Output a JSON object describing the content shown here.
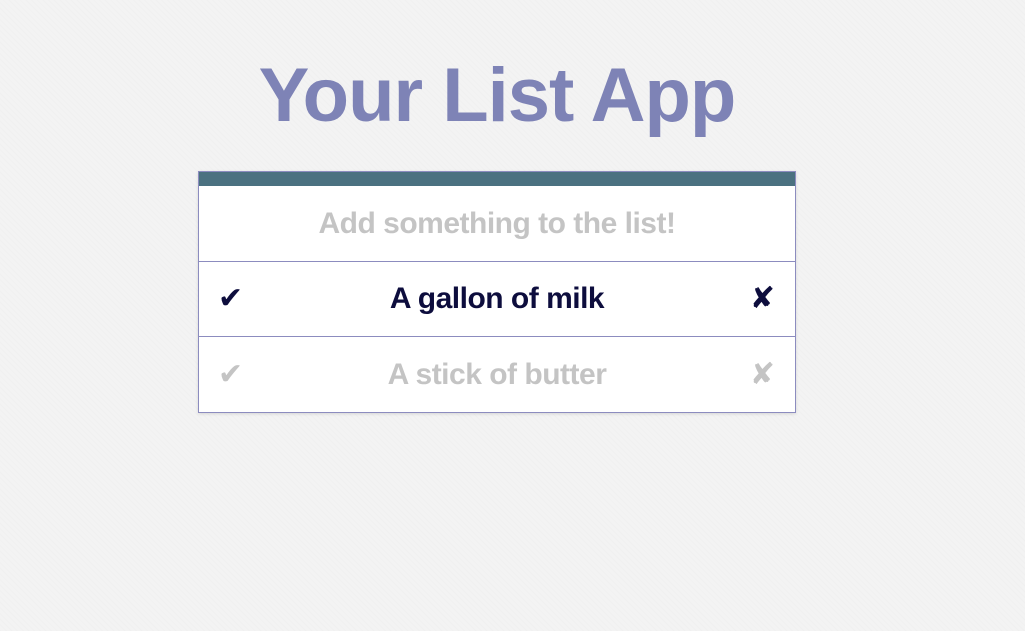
{
  "app": {
    "title": "Your List App"
  },
  "input": {
    "placeholder": "Add something to the list!",
    "value": ""
  },
  "items": [
    {
      "label": "A gallon of milk",
      "done": false,
      "check_icon": "✔",
      "delete_icon": "✘"
    },
    {
      "label": "A stick of butter",
      "done": true,
      "check_icon": "✔",
      "delete_icon": "✘"
    }
  ],
  "icons": {
    "check": "check-icon",
    "delete": "x-icon"
  },
  "colors": {
    "title": "#7e83b6",
    "top_bar": "#4b7180",
    "border": "#8c8cbf",
    "active_text": "#0d0d3d",
    "done_text": "#c4c4c4"
  }
}
